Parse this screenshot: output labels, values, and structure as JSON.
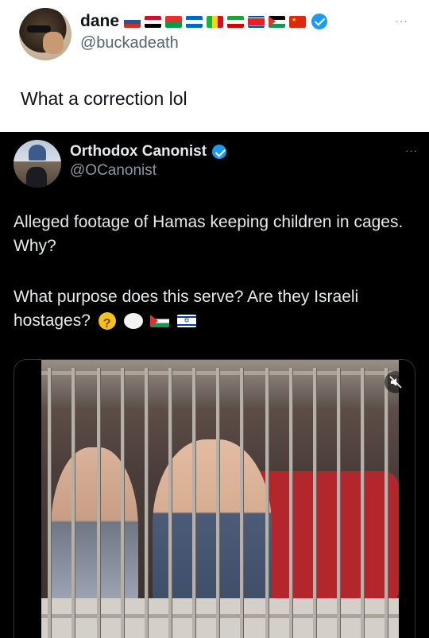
{
  "outer_tweet": {
    "display_name": "dane",
    "handle": "@buckadeath",
    "text": "What a correction lol",
    "more_label": "···",
    "name_flags": [
      "russia",
      "iraq",
      "burkina-faso",
      "nicaragua",
      "mali",
      "iran",
      "north-korea",
      "palestine",
      "china"
    ]
  },
  "quoted_tweet": {
    "display_name": "Orthodox Canonist",
    "handle": "@OCanonist",
    "more_label": "···",
    "paragraph1": "Alleged footage of Hamas keeping children in cages. Why?",
    "paragraph2": "What purpose does this serve? Are they Israeli hostages?",
    "emojis": [
      "thinking-face",
      "thought-balloon",
      "palestine-flag",
      "israel-flag"
    ],
    "media": {
      "type": "video",
      "mute_icon": "volume-off-icon"
    }
  },
  "colors": {
    "verified": "#1d9bf0",
    "outer_bg": "#ffffff",
    "quoted_bg": "#000000",
    "secondary_text_light": "#536471",
    "secondary_text_dark": "#8b98a5"
  }
}
